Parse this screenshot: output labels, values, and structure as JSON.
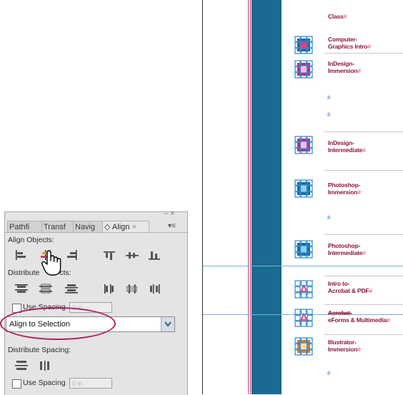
{
  "document": {
    "header": "Class",
    "courses": [
      {
        "line1": "Computer-",
        "line2": "Graphics Intro"
      },
      {
        "line1": "InDesign-",
        "line2": "Immersion"
      },
      {
        "line1": "InDesign-",
        "line2": "Intermediate"
      },
      {
        "line1": "Photoshop-",
        "line2": "Immersion"
      },
      {
        "line1": "Photoshop-",
        "line2": "Intermediate"
      },
      {
        "line1": "Intro to-",
        "line2": "Acrobat & PDF"
      },
      {
        "line1": "Acrobat-",
        "line2": "eForms & Multimedia"
      },
      {
        "line1": "Illustrator-",
        "line2": "Immersion"
      }
    ],
    "colors": {
      "bar": "#1b6a92",
      "text": "#8b1a3a",
      "marker": "#e0407a",
      "frame": "#2a8ad8"
    }
  },
  "panel": {
    "tabs": [
      {
        "label": "Pathfi"
      },
      {
        "label": "Transf"
      },
      {
        "label": "Navig"
      },
      {
        "label": "◇ Align",
        "active": true
      }
    ],
    "close_glyph": "×",
    "menu_glyph": "▾≡",
    "collapse_glyph": "– ×",
    "align_objects_label": "Align Objects:",
    "distribute_objects_label": "Distribute Objects:",
    "distribute_objects_visible_prefix": "Distribute",
    "distribute_objects_visible_suffix": "cts:",
    "use_spacing_label": "Use Spacing",
    "spacing_value": "0 in",
    "align_to_value": "Align to Selection",
    "distribute_spacing_label": "Distribute Spacing:",
    "use_spacing_label_2": "Use Spacing",
    "spacing_value_2": "0 in",
    "highlight_color": "#b01e5e"
  }
}
